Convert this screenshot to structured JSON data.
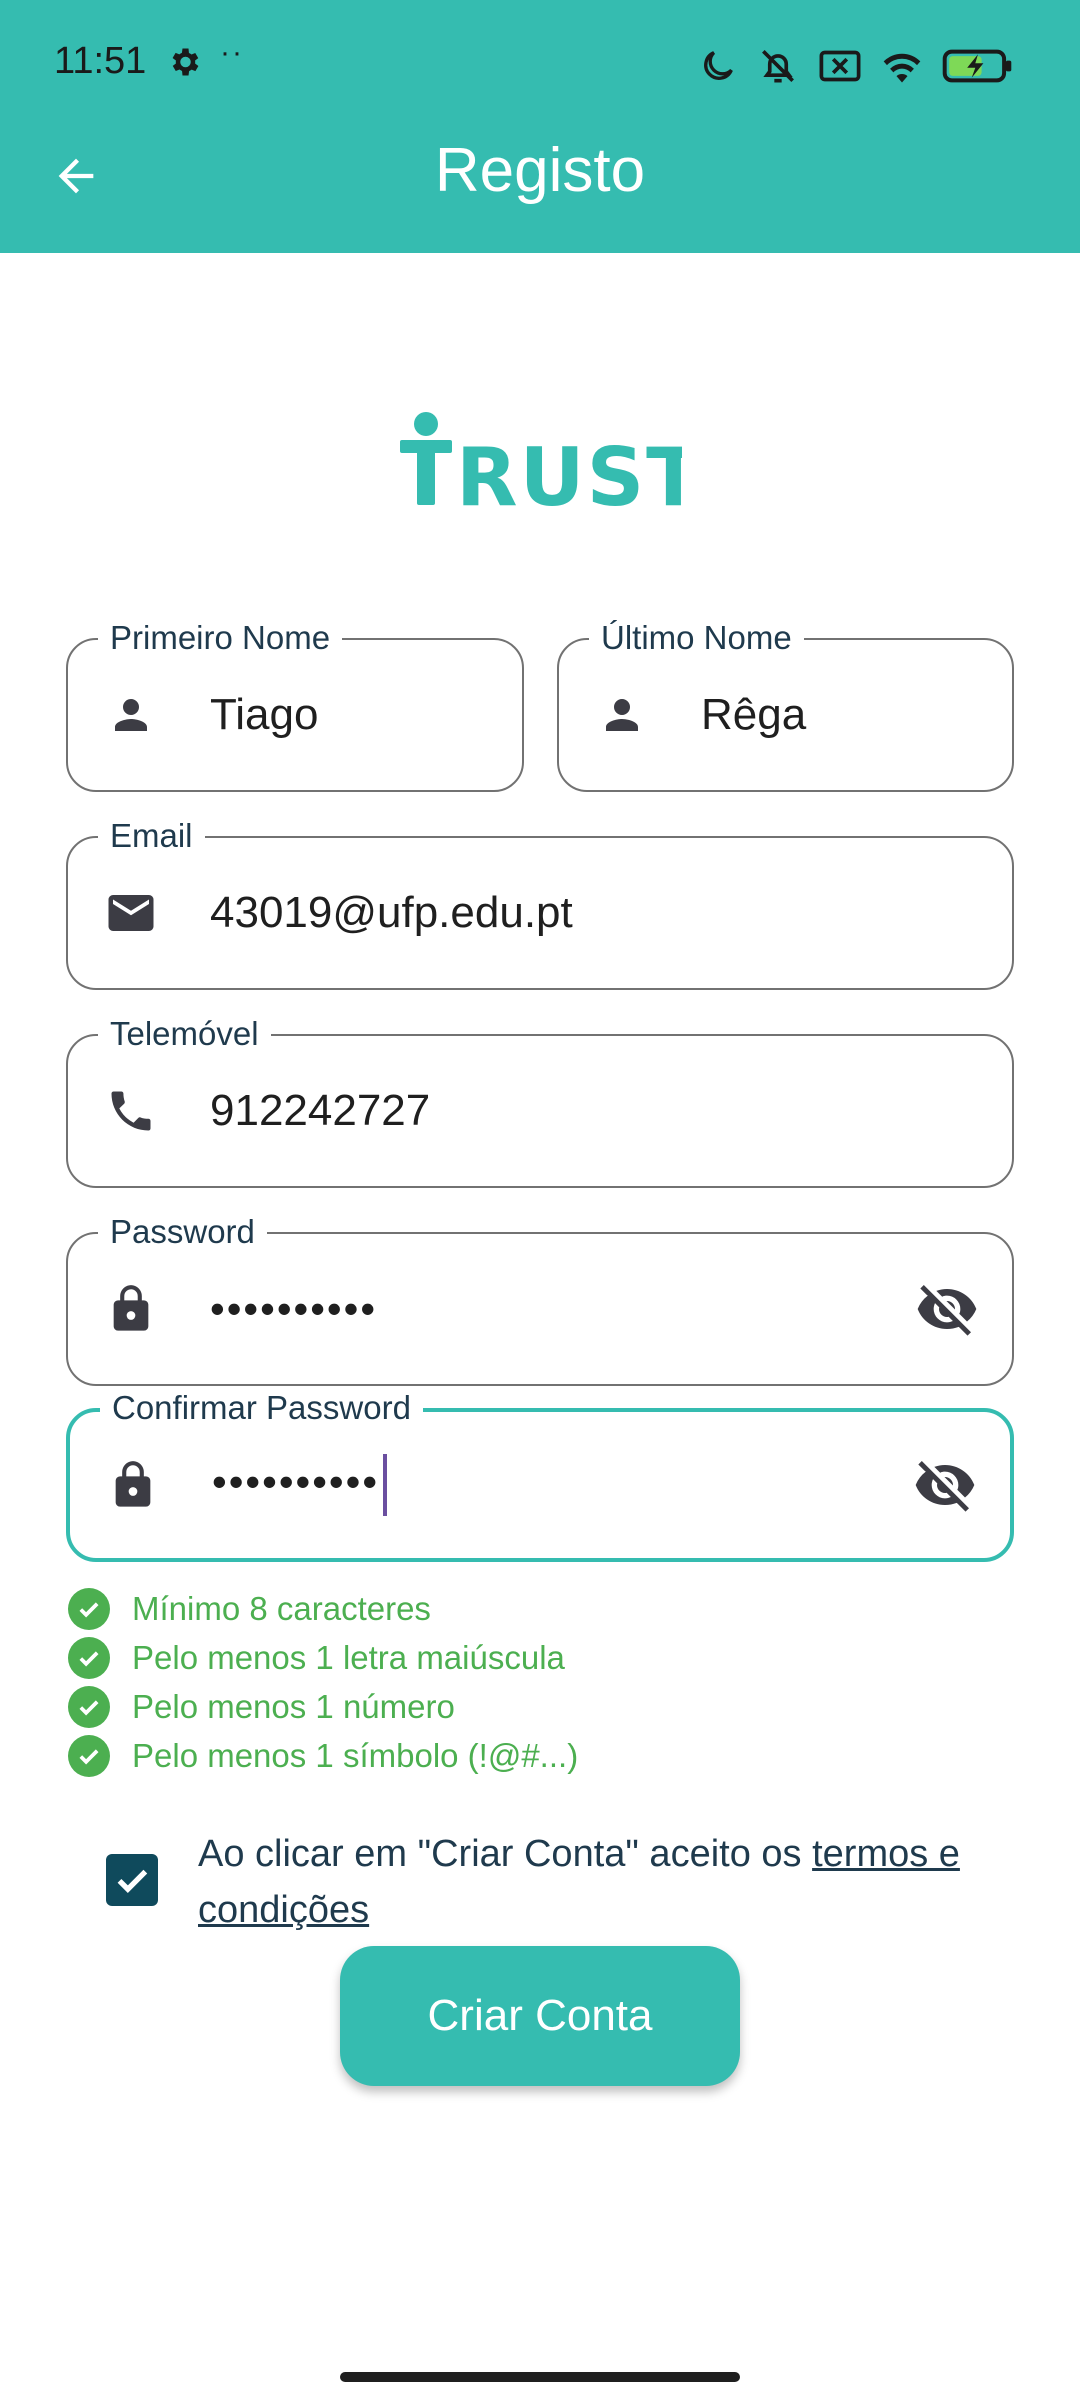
{
  "status_bar": {
    "time": "11:51",
    "dots": "··"
  },
  "header": {
    "title": "Registo"
  },
  "logo_text": "TRUST",
  "form": {
    "first_name": {
      "label": "Primeiro Nome",
      "value": "Tiago",
      "icon": "person-icon"
    },
    "last_name": {
      "label": "Último Nome",
      "value": "Rêga",
      "icon": "person-icon"
    },
    "email": {
      "label": "Email",
      "value": "43019@ufp.edu.pt",
      "icon": "mail-icon"
    },
    "phone": {
      "label": "Telemóvel",
      "value": "912242727",
      "icon": "phone-icon"
    },
    "password": {
      "label": "Password",
      "value": "••••••••••",
      "icon": "lock-icon"
    },
    "confirm_password": {
      "label": "Confirmar Password",
      "value": "••••••••••",
      "icon": "lock-icon"
    }
  },
  "requirements": [
    "Mínimo 8 caracteres",
    "Pelo menos 1 letra maiúscula",
    "Pelo menos 1 número",
    "Pelo menos 1 símbolo (!@#...)"
  ],
  "terms": {
    "prefix": "Ao clicar em \"Criar Conta\" aceito os ",
    "link": "termos e condições",
    "checked": true
  },
  "create_button": "Criar Conta",
  "colors": {
    "accent": "#35bcb0",
    "success": "#4caf50",
    "checkbox": "#0f4a5c",
    "text_dark": "#1f3a4d"
  }
}
